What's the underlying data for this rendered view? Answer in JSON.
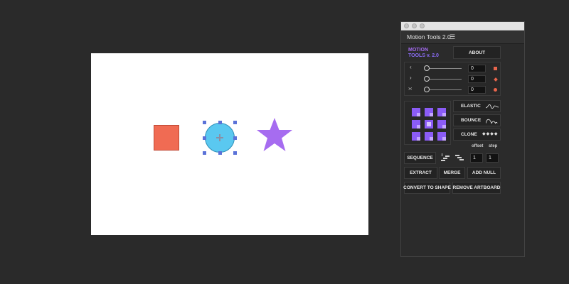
{
  "panel": {
    "tab_title": "Motion Tools 2.0",
    "menu_icon": "hamburger-menu-icon",
    "logo_line1": "MOTION",
    "logo_line2": "TOOLS v. 2.0",
    "about_label": "ABOUT"
  },
  "sliders": [
    {
      "icon": "chevron-left-icon",
      "glyph": "‹",
      "value": "0",
      "marker": "square-keyframe-icon"
    },
    {
      "icon": "chevron-right-icon",
      "glyph": "›",
      "value": "0",
      "marker": "diamond-keyframe-icon"
    },
    {
      "icon": "chevron-both-icon",
      "glyph": "›‹",
      "value": "0",
      "marker": "circle-keyframe-icon"
    }
  ],
  "effects": {
    "elastic_label": "ELASTIC",
    "bounce_label": "BOUNCE",
    "clone_label": "CLONE",
    "offset_label": "offset",
    "step_label": "step"
  },
  "sequence": {
    "label": "SEQUENCE",
    "offset_value": "1",
    "step_value": "1"
  },
  "actions": {
    "extract": "EXTRACT",
    "merge": "MERGE",
    "add_null": "ADD NULL",
    "convert_to_shape": "CONVERT TO SHAPE",
    "remove_artboard": "REMOVE ARTBOARD"
  },
  "colors": {
    "accent": "#8b5cf6",
    "square_fill": "#f06b53",
    "circle_fill": "#5ac8f0",
    "star_fill": "#a66cf0",
    "keyframe_marker": "#e8654c",
    "selection_handle": "#5b72d8"
  }
}
